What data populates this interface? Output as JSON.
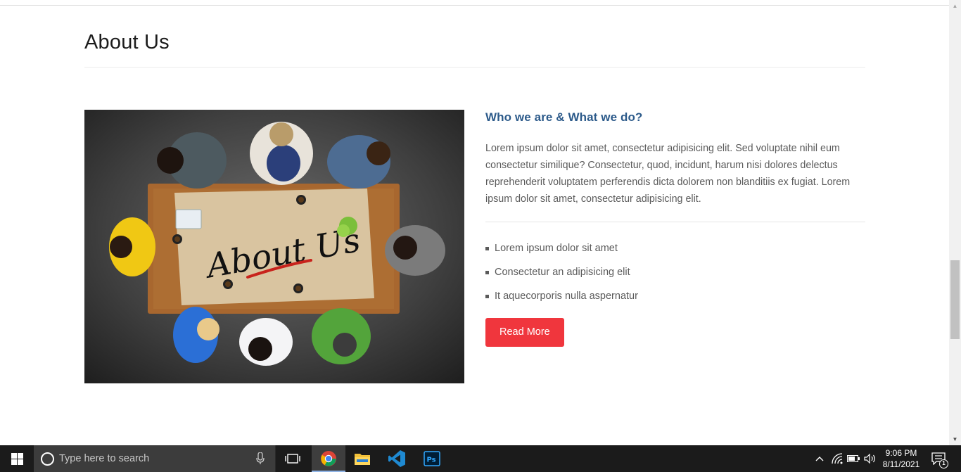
{
  "page": {
    "title": "About Us",
    "subtitle": "Who we are & What we do?",
    "paragraph": "Lorem ipsum dolor sit amet, consectetur adipisicing elit. Sed voluptate nihil eum consectetur similique? Consectetur, quod, incidunt, harum nisi dolores delectus reprehenderit voluptatem perferendis dicta dolorem non blanditiis ex fugiat. Lorem ipsum dolor sit amet, consectetur adipisicing elit.",
    "list": [
      "Lorem ipsum dolor sit amet",
      "Consectetur an adipisicing elit",
      "It aquecorporis nulla aspernatur"
    ],
    "button_label": "Read More",
    "image_text": "About Us",
    "accent_color": "#f0363d",
    "subtitle_color": "#2c5a8a"
  },
  "taskbar": {
    "search_placeholder": "Type here to search",
    "time": "9:06 PM",
    "date": "8/11/2021",
    "notification_count": "1",
    "pinned_apps": [
      "chrome-icon",
      "file-explorer-icon",
      "vscode-icon",
      "photoshop-icon"
    ],
    "photoshop_label": "Ps"
  }
}
